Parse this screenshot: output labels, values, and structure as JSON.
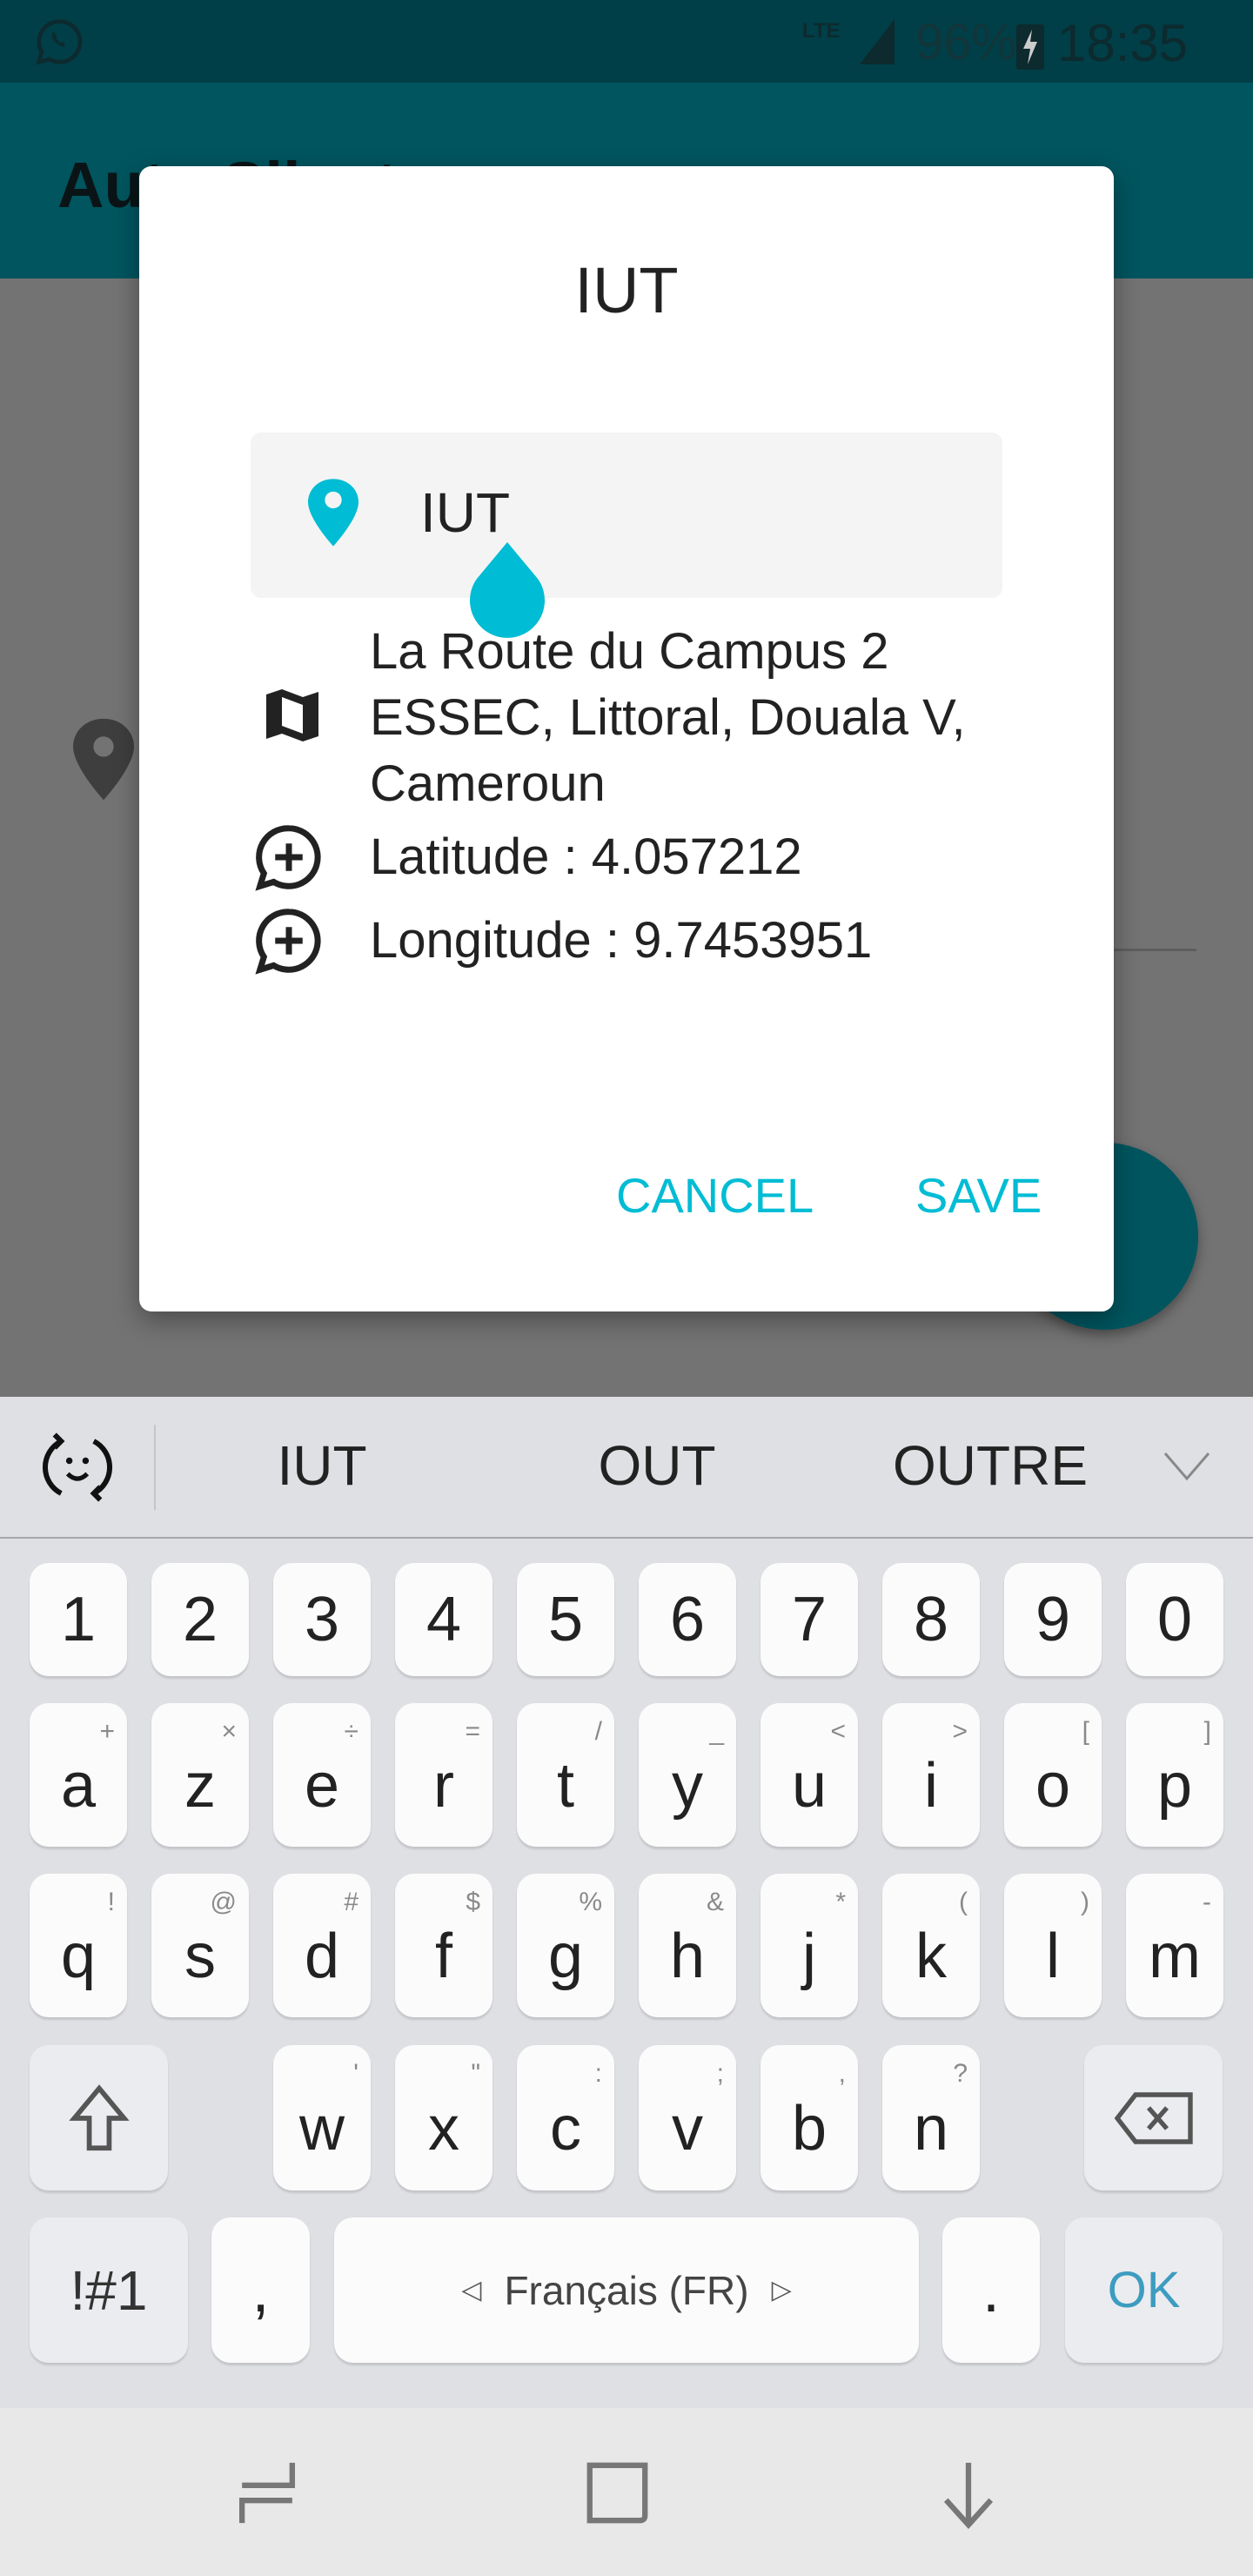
{
  "status_bar": {
    "notification_icon": "whatsapp-icon",
    "network": "LTE",
    "battery": "96%",
    "time": "18:35"
  },
  "app_bar": {
    "title": "Auto Silent"
  },
  "dialog": {
    "title": "IUT",
    "name_input": {
      "value": "IUT",
      "icon": "location-pin-icon"
    },
    "address_lines": [
      "La Route du Campus 2",
      "ESSEC, Littoral, Douala V,",
      "Cameroun"
    ],
    "latitude": "Latitude : 4.057212",
    "longitude": "Longitude : 9.7453951",
    "cancel_label": "CANCEL",
    "save_label": "SAVE",
    "accent": "#00bcd4"
  },
  "keyboard": {
    "suggestions": [
      "IUT",
      "OUT",
      "OUTRE"
    ],
    "rows": [
      [
        [
          "1",
          ""
        ],
        [
          "2",
          ""
        ],
        [
          "3",
          ""
        ],
        [
          "4",
          ""
        ],
        [
          "5",
          ""
        ],
        [
          "6",
          ""
        ],
        [
          "7",
          ""
        ],
        [
          "8",
          ""
        ],
        [
          "9",
          ""
        ],
        [
          "0",
          ""
        ]
      ],
      [
        [
          "a",
          "+"
        ],
        [
          "z",
          "×"
        ],
        [
          "e",
          "÷"
        ],
        [
          "r",
          "="
        ],
        [
          "t",
          "/"
        ],
        [
          "y",
          "_"
        ],
        [
          "u",
          "<"
        ],
        [
          "i",
          ">"
        ],
        [
          "o",
          "["
        ],
        [
          "p",
          "]"
        ]
      ],
      [
        [
          "q",
          "!"
        ],
        [
          "s",
          "@"
        ],
        [
          "d",
          "#"
        ],
        [
          "f",
          "$"
        ],
        [
          "g",
          "%"
        ],
        [
          "h",
          "&"
        ],
        [
          "j",
          "*"
        ],
        [
          "k",
          "("
        ],
        [
          "l",
          ")"
        ],
        [
          "m",
          "-"
        ]
      ],
      [
        [
          "w",
          "'"
        ],
        [
          "x",
          "\""
        ],
        [
          "c",
          ":"
        ],
        [
          "v",
          ";"
        ],
        [
          "b",
          ","
        ],
        [
          "n",
          "?"
        ]
      ]
    ],
    "symbols_label": "!#1",
    "comma": ",",
    "space_label": "Français (FR)",
    "period": ".",
    "ok_label": "OK",
    "ok_color": "#3d9cc0"
  }
}
